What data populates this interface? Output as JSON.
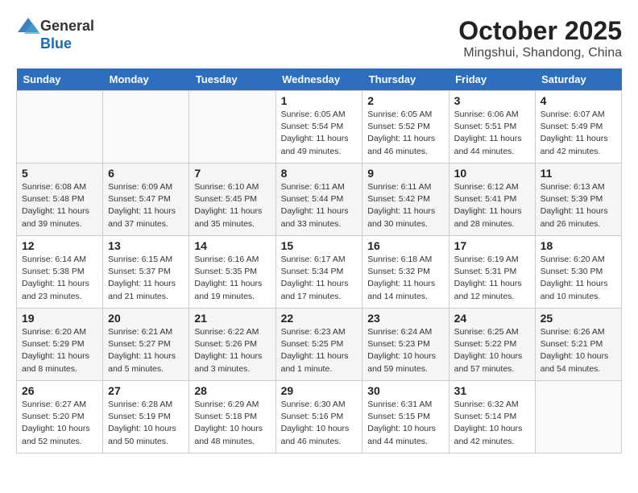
{
  "header": {
    "logo_general": "General",
    "logo_blue": "Blue",
    "month": "October 2025",
    "location": "Mingshui, Shandong, China"
  },
  "weekdays": [
    "Sunday",
    "Monday",
    "Tuesday",
    "Wednesday",
    "Thursday",
    "Friday",
    "Saturday"
  ],
  "weeks": [
    [
      {
        "day": "",
        "info": ""
      },
      {
        "day": "",
        "info": ""
      },
      {
        "day": "",
        "info": ""
      },
      {
        "day": "1",
        "info": "Sunrise: 6:05 AM\nSunset: 5:54 PM\nDaylight: 11 hours\nand 49 minutes."
      },
      {
        "day": "2",
        "info": "Sunrise: 6:05 AM\nSunset: 5:52 PM\nDaylight: 11 hours\nand 46 minutes."
      },
      {
        "day": "3",
        "info": "Sunrise: 6:06 AM\nSunset: 5:51 PM\nDaylight: 11 hours\nand 44 minutes."
      },
      {
        "day": "4",
        "info": "Sunrise: 6:07 AM\nSunset: 5:49 PM\nDaylight: 11 hours\nand 42 minutes."
      }
    ],
    [
      {
        "day": "5",
        "info": "Sunrise: 6:08 AM\nSunset: 5:48 PM\nDaylight: 11 hours\nand 39 minutes."
      },
      {
        "day": "6",
        "info": "Sunrise: 6:09 AM\nSunset: 5:47 PM\nDaylight: 11 hours\nand 37 minutes."
      },
      {
        "day": "7",
        "info": "Sunrise: 6:10 AM\nSunset: 5:45 PM\nDaylight: 11 hours\nand 35 minutes."
      },
      {
        "day": "8",
        "info": "Sunrise: 6:11 AM\nSunset: 5:44 PM\nDaylight: 11 hours\nand 33 minutes."
      },
      {
        "day": "9",
        "info": "Sunrise: 6:11 AM\nSunset: 5:42 PM\nDaylight: 11 hours\nand 30 minutes."
      },
      {
        "day": "10",
        "info": "Sunrise: 6:12 AM\nSunset: 5:41 PM\nDaylight: 11 hours\nand 28 minutes."
      },
      {
        "day": "11",
        "info": "Sunrise: 6:13 AM\nSunset: 5:39 PM\nDaylight: 11 hours\nand 26 minutes."
      }
    ],
    [
      {
        "day": "12",
        "info": "Sunrise: 6:14 AM\nSunset: 5:38 PM\nDaylight: 11 hours\nand 23 minutes."
      },
      {
        "day": "13",
        "info": "Sunrise: 6:15 AM\nSunset: 5:37 PM\nDaylight: 11 hours\nand 21 minutes."
      },
      {
        "day": "14",
        "info": "Sunrise: 6:16 AM\nSunset: 5:35 PM\nDaylight: 11 hours\nand 19 minutes."
      },
      {
        "day": "15",
        "info": "Sunrise: 6:17 AM\nSunset: 5:34 PM\nDaylight: 11 hours\nand 17 minutes."
      },
      {
        "day": "16",
        "info": "Sunrise: 6:18 AM\nSunset: 5:32 PM\nDaylight: 11 hours\nand 14 minutes."
      },
      {
        "day": "17",
        "info": "Sunrise: 6:19 AM\nSunset: 5:31 PM\nDaylight: 11 hours\nand 12 minutes."
      },
      {
        "day": "18",
        "info": "Sunrise: 6:20 AM\nSunset: 5:30 PM\nDaylight: 11 hours\nand 10 minutes."
      }
    ],
    [
      {
        "day": "19",
        "info": "Sunrise: 6:20 AM\nSunset: 5:29 PM\nDaylight: 11 hours\nand 8 minutes."
      },
      {
        "day": "20",
        "info": "Sunrise: 6:21 AM\nSunset: 5:27 PM\nDaylight: 11 hours\nand 5 minutes."
      },
      {
        "day": "21",
        "info": "Sunrise: 6:22 AM\nSunset: 5:26 PM\nDaylight: 11 hours\nand 3 minutes."
      },
      {
        "day": "22",
        "info": "Sunrise: 6:23 AM\nSunset: 5:25 PM\nDaylight: 11 hours\nand 1 minute."
      },
      {
        "day": "23",
        "info": "Sunrise: 6:24 AM\nSunset: 5:23 PM\nDaylight: 10 hours\nand 59 minutes."
      },
      {
        "day": "24",
        "info": "Sunrise: 6:25 AM\nSunset: 5:22 PM\nDaylight: 10 hours\nand 57 minutes."
      },
      {
        "day": "25",
        "info": "Sunrise: 6:26 AM\nSunset: 5:21 PM\nDaylight: 10 hours\nand 54 minutes."
      }
    ],
    [
      {
        "day": "26",
        "info": "Sunrise: 6:27 AM\nSunset: 5:20 PM\nDaylight: 10 hours\nand 52 minutes."
      },
      {
        "day": "27",
        "info": "Sunrise: 6:28 AM\nSunset: 5:19 PM\nDaylight: 10 hours\nand 50 minutes."
      },
      {
        "day": "28",
        "info": "Sunrise: 6:29 AM\nSunset: 5:18 PM\nDaylight: 10 hours\nand 48 minutes."
      },
      {
        "day": "29",
        "info": "Sunrise: 6:30 AM\nSunset: 5:16 PM\nDaylight: 10 hours\nand 46 minutes."
      },
      {
        "day": "30",
        "info": "Sunrise: 6:31 AM\nSunset: 5:15 PM\nDaylight: 10 hours\nand 44 minutes."
      },
      {
        "day": "31",
        "info": "Sunrise: 6:32 AM\nSunset: 5:14 PM\nDaylight: 10 hours\nand 42 minutes."
      },
      {
        "day": "",
        "info": ""
      }
    ]
  ]
}
